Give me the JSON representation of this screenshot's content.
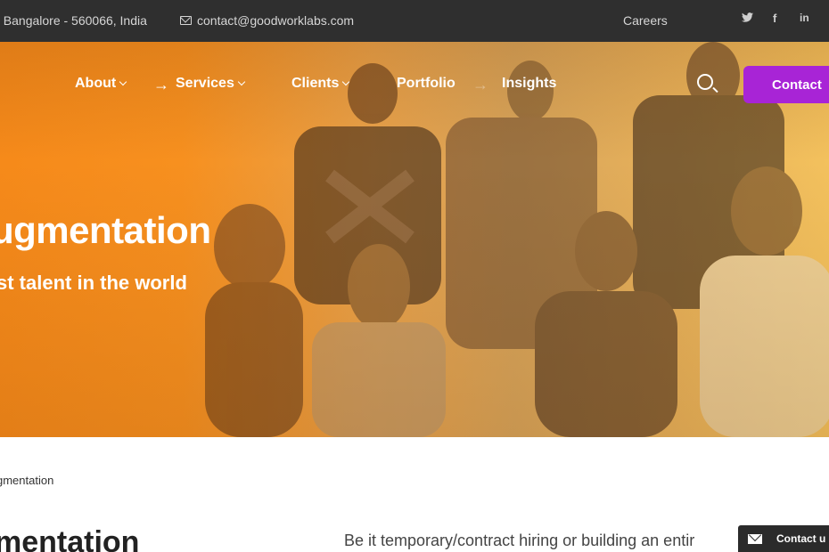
{
  "topbar": {
    "address": ", Bangalore - 560066, India",
    "email": "contact@goodworklabs.com",
    "careers": "Careers",
    "social": [
      {
        "icon": "twitter-icon",
        "glyph": "🐦︎"
      },
      {
        "icon": "facebook-icon",
        "glyph": "f"
      },
      {
        "icon": "linkedin-icon",
        "glyph": "in"
      }
    ]
  },
  "nav": {
    "about": "About",
    "services": "Services",
    "clients": "Clients",
    "portfolio": "Portfolio",
    "insights": "Insights",
    "contact": "Contact"
  },
  "hero": {
    "title": "ugmentation",
    "subtitle": "st talent in the world"
  },
  "content": {
    "breadcrumb": "gmentation",
    "section_title": "mentation",
    "paragraph": "Be it temporary/contract hiring or building an entir"
  },
  "widget": {
    "label": "Contact u"
  },
  "colors": {
    "accent": "#a824d6",
    "hero_orange": "#f68a1a",
    "topbar_bg": "#2f2f2f"
  }
}
